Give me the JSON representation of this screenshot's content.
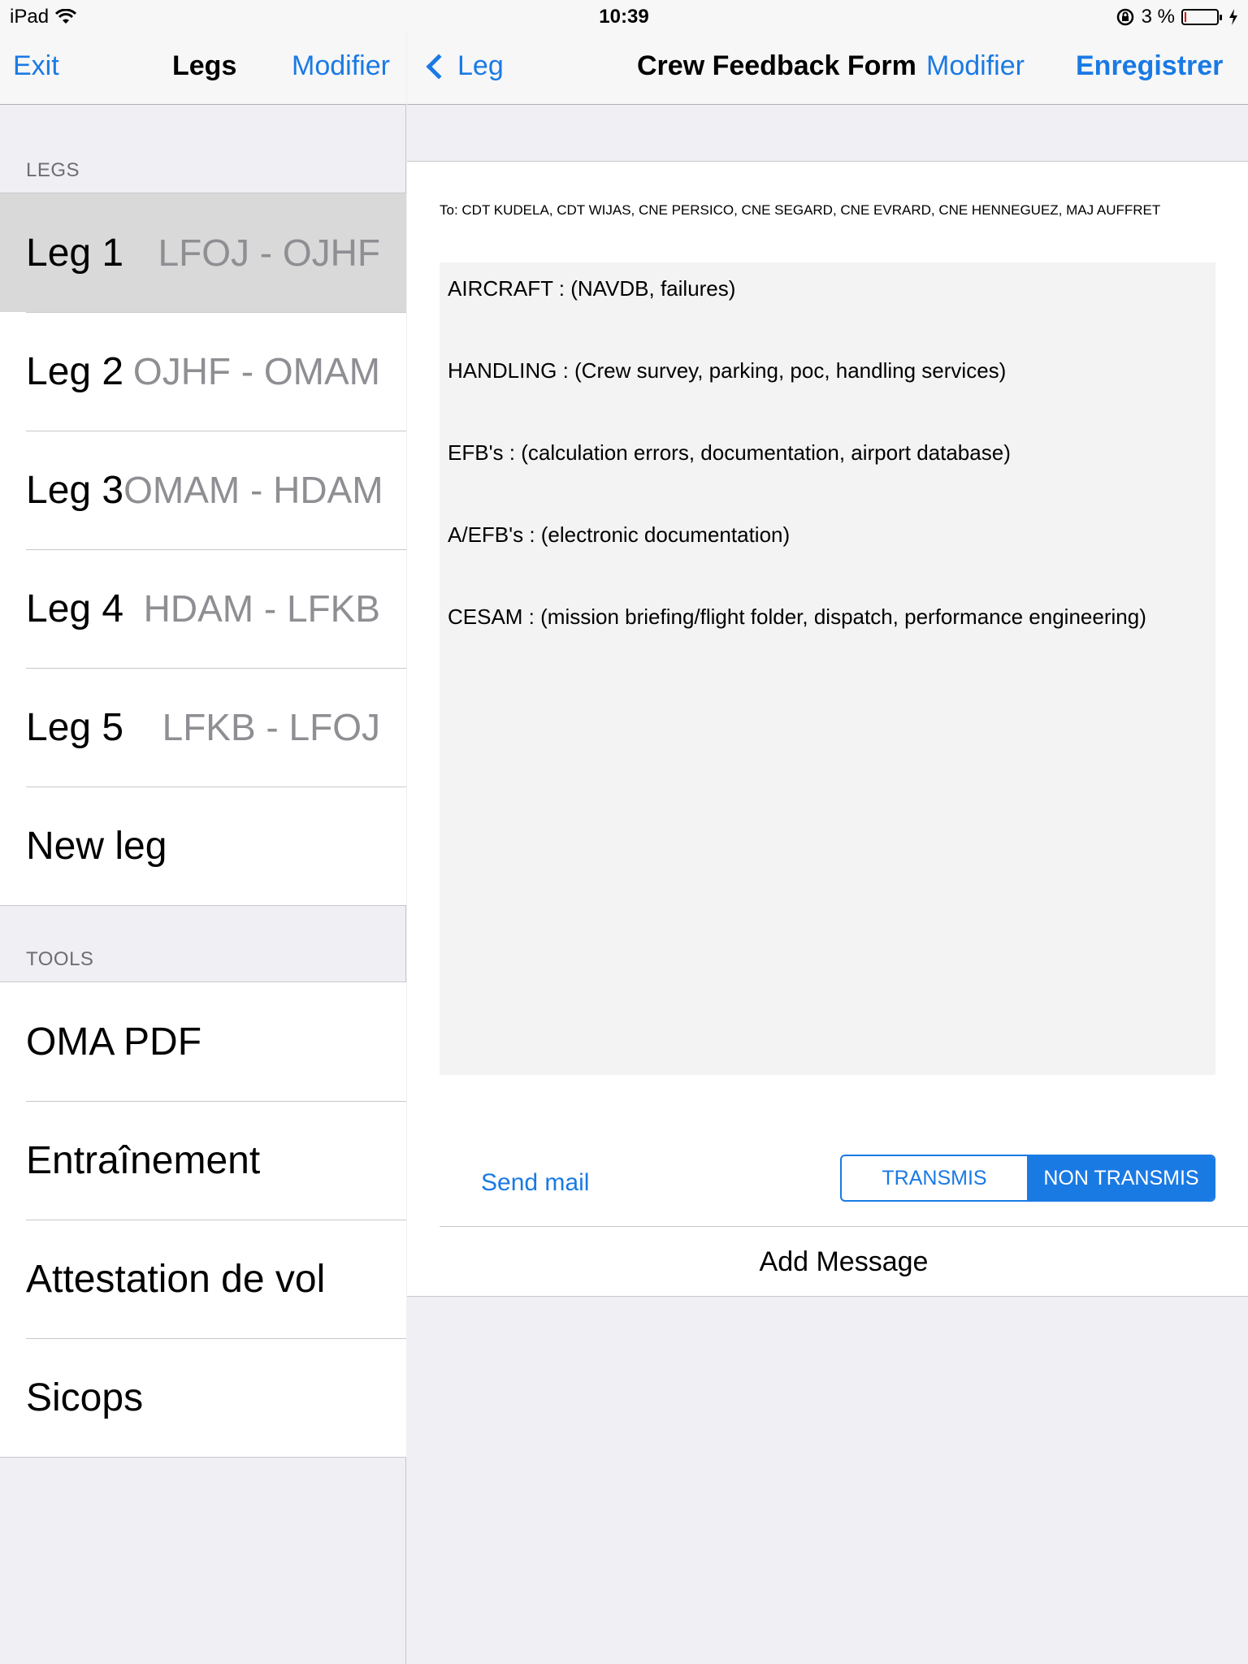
{
  "status_bar": {
    "device": "iPad",
    "time": "10:39",
    "battery": "3 %"
  },
  "left_nav": {
    "exit_label": "Exit",
    "title": "Legs",
    "edit_label": "Modifier"
  },
  "legs_section": {
    "header": "LEGS",
    "items": [
      {
        "label": "Leg 1",
        "route": "LFOJ - OJHF",
        "selected": true
      },
      {
        "label": "Leg 2",
        "route": "OJHF - OMAM",
        "selected": false
      },
      {
        "label": "Leg 3",
        "route": "OMAM - HDAM",
        "selected": false
      },
      {
        "label": "Leg 4",
        "route": "HDAM - LFKB",
        "selected": false
      },
      {
        "label": "Leg 5",
        "route": "LFKB - LFOJ",
        "selected": false
      },
      {
        "label": "New leg",
        "route": "",
        "selected": false
      }
    ]
  },
  "tools_section": {
    "header": "TOOLS",
    "items": [
      {
        "label": "OMA PDF"
      },
      {
        "label": "Entraînement"
      },
      {
        "label": "Attestation de vol"
      },
      {
        "label": "Sicops"
      }
    ]
  },
  "right_nav": {
    "back_label": "Leg",
    "title": "Crew Feedback Form",
    "edit_label": "Modifier",
    "save_label": "Enregistrer"
  },
  "form": {
    "recipients": "To: CDT KUDELA, CDT WIJAS, CNE PERSICO, CNE SEGARD, CNE EVRARD, CNE HENNEGUEZ, MAJ AUFFRET",
    "lines": [
      "AIRCRAFT : (NAVDB, failures)",
      "HANDLING : (Crew survey, parking, poc, handling services)",
      "EFB's : (calculation errors, documentation, airport database)",
      "A/EFB's : (electronic documentation)",
      "CESAM : (mission briefing/flight folder, dispatch, performance engineering)"
    ],
    "send_mail_label": "Send mail",
    "segments": [
      {
        "label": "TRANSMIS",
        "active": false
      },
      {
        "label": "NON TRANSMIS",
        "active": true
      }
    ],
    "add_message_label": "Add Message"
  },
  "colors": {
    "accent": "#1a7ae4",
    "selected_row": "#d9d9d9",
    "background": "#efeff4",
    "secondary_text": "#8e8e93"
  },
  "icons": [
    "wifi-icon",
    "rotation-lock-icon",
    "battery-icon",
    "charging-icon",
    "chevron-left-icon"
  ]
}
